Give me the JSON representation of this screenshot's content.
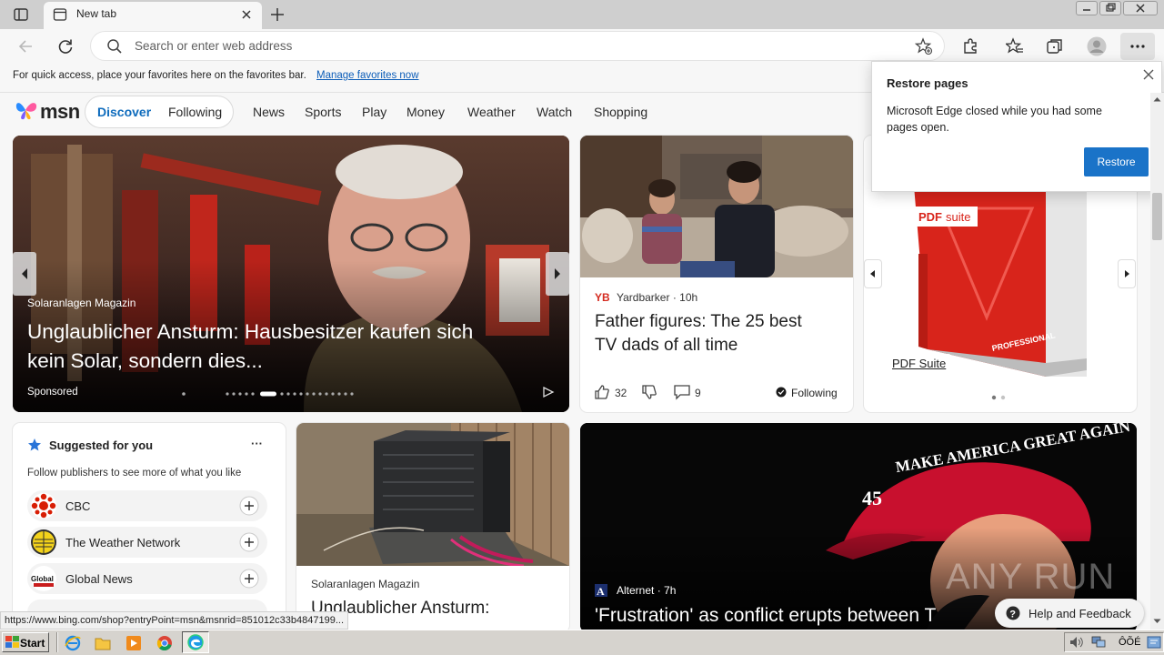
{
  "browser": {
    "tab_title": "New tab",
    "address_placeholder": "Search or enter web address",
    "favorites_hint": "For quick access, place your favorites here on the favorites bar.",
    "favorites_link": "Manage favorites now"
  },
  "msn": {
    "logo": "msn",
    "discover": "Discover",
    "following": "Following",
    "nav": [
      "News",
      "Sports",
      "Play",
      "Money",
      "Weather",
      "Watch",
      "Shopping"
    ]
  },
  "hero": {
    "source": "Solaranlagen Magazin",
    "title_line1": "Unglaublicher Ansturm: Hausbesitzer kaufen sich",
    "title_line2": "kein Solar, sondern dies...",
    "sponsored": "Sponsored"
  },
  "card2": {
    "publisher": "Yardbarker",
    "age": "10h",
    "title_line1": "Father figures: The 25 best",
    "title_line2": "TV dads of all time",
    "likes": "32",
    "comments": "9",
    "follow": "Following"
  },
  "card3": {
    "label": "PDF Suite",
    "product_badge": "PROFESSIONAL"
  },
  "restore": {
    "title": "Restore pages",
    "body_line1": "Microsoft Edge closed while you had some",
    "body_line2": "pages open.",
    "button": "Restore"
  },
  "suggested": {
    "title": "Suggested for you",
    "more": "···",
    "subtitle": "Follow publishers to see more of what you like",
    "publishers": [
      "CBC",
      "The Weather Network",
      "Global News"
    ]
  },
  "card_ac": {
    "source": "Solaranlagen Magazin",
    "title": "Unglaublicher Ansturm:"
  },
  "card_trump": {
    "publisher": "Alternet",
    "age": "7h",
    "title": "'Frustration' as conflict erupts between T",
    "cap_text": "MAKE AMERICA GREAT AGAIN",
    "cap_num": "45"
  },
  "watermark": "ANY RUN",
  "help": "Help and Feedback",
  "status_url": "https://www.bing.com/shop?entryPoint=msn&msnrid=851012c33b4847199...",
  "taskbar": {
    "start": "Start",
    "tray_text": "ÔÕÉ"
  },
  "colors": {
    "accent": "#1a73c8",
    "link": "#0c5db8",
    "discover": "#0f6cbd"
  }
}
